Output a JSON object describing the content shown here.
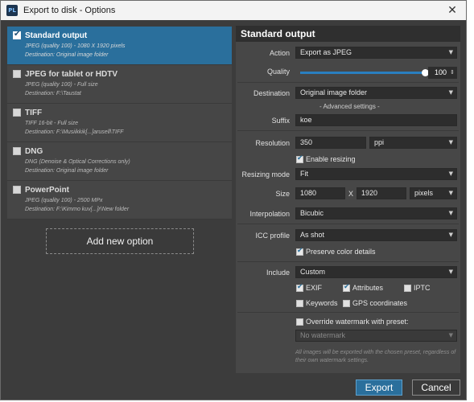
{
  "window": {
    "title": "Export to disk - Options",
    "app_icon_text": "PL",
    "close_glyph": "✕"
  },
  "options": [
    {
      "name": "Standard output",
      "line1": "JPEG (quality 100) - 1080 X 1920 pixels",
      "line2": "Destination: Original image folder",
      "checked": true,
      "selected": true
    },
    {
      "name": "JPEG for tablet or HDTV",
      "line1": "JPEG (quality 100) - Full size",
      "line2": "Destination: F:\\Taustat",
      "checked": false,
      "selected": false
    },
    {
      "name": "TIFF",
      "line1": "TIFF 16-bit - Full size",
      "line2": "Destination: F:\\Musiikkik[...]arusell\\TIFF",
      "checked": false,
      "selected": false
    },
    {
      "name": "DNG",
      "line1": "DNG (Denoise & Optical Corrections only)",
      "line2": "Destination: Original image folder",
      "checked": false,
      "selected": false
    },
    {
      "name": "PowerPoint",
      "line1": "JPEG (quality 100) - 2500 MPx",
      "line2": "Destination: F:\\Kimmo kuv[...]r\\New folder",
      "checked": false,
      "selected": false
    }
  ],
  "add_option_label": "Add new option",
  "panel": {
    "title": "Standard output",
    "action": {
      "label": "Action",
      "value": "Export as JPEG"
    },
    "quality": {
      "label": "Quality",
      "value": "100",
      "fraction": 1.0
    },
    "destination": {
      "label": "Destination",
      "value": "Original image folder"
    },
    "advanced_settings": "- Advanced settings -",
    "suffix": {
      "label": "Suffix",
      "value": "koe"
    },
    "resolution": {
      "label": "Resolution",
      "value": "350",
      "unit": "ppi"
    },
    "enable_resizing": {
      "label": "Enable resizing",
      "checked": true
    },
    "resizing_mode": {
      "label": "Resizing mode",
      "value": "Fit"
    },
    "size": {
      "label": "Size",
      "width": "1080",
      "x": "X",
      "height": "1920",
      "unit": "pixels"
    },
    "interpolation": {
      "label": "Interpolation",
      "value": "Bicubic"
    },
    "icc_profile": {
      "label": "ICC profile",
      "value": "As shot"
    },
    "preserve_color": {
      "label": "Preserve color details",
      "checked": true
    },
    "include": {
      "label": "Include",
      "value": "Custom"
    },
    "exif": {
      "label": "EXIF",
      "checked": true
    },
    "attributes": {
      "label": "Attributes",
      "checked": true
    },
    "iptc": {
      "label": "IPTC",
      "checked": false
    },
    "keywords": {
      "label": "Keywords",
      "checked": false
    },
    "gps": {
      "label": "GPS coordinates",
      "checked": false
    },
    "override_watermark": {
      "label": "Override watermark with preset:",
      "checked": false
    },
    "watermark": {
      "value": "No watermark"
    },
    "watermark_note": "All images will be exported with the chosen preset, regardless of their own watermark settings."
  },
  "buttons": {
    "export": "Export",
    "cancel": "Cancel"
  },
  "colors": {
    "accent": "#2a6f9c",
    "panel": "#474747",
    "window": "#3c3c3c"
  }
}
